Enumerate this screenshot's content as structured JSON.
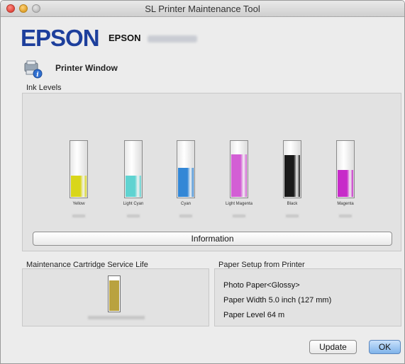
{
  "window": {
    "title": "SL Printer Maintenance Tool"
  },
  "brand": {
    "logo": "EPSON",
    "model_prefix": "EPSON"
  },
  "printer_window": {
    "label": "Printer Window",
    "icon": "printer-info-icon"
  },
  "ink": {
    "section_label": "Ink Levels",
    "tanks": [
      {
        "name": "Yellow",
        "level": 0.37,
        "color": "#d9d61a"
      },
      {
        "name": "Light Cyan",
        "level": 0.37,
        "color": "#5fd3d1"
      },
      {
        "name": "Cyan",
        "level": 0.51,
        "color": "#3387d6"
      },
      {
        "name": "Light Magenta",
        "level": 0.75,
        "color": "#d35fd5"
      },
      {
        "name": "Black",
        "level": 0.74,
        "color": "#1a1a1a"
      },
      {
        "name": "Magenta",
        "level": 0.47,
        "color": "#c72bc9"
      }
    ],
    "info_button": "Information"
  },
  "maintenance": {
    "section_label": "Maintenance Cartridge Service Life",
    "level": 0.9,
    "color": "#b9a23f"
  },
  "paper": {
    "section_label": "Paper Setup from Printer",
    "lines": [
      "Photo Paper<Glossy>",
      "Paper Width 5.0 inch (127 mm)",
      "Paper Level 64 m"
    ]
  },
  "buttons": {
    "update": "Update",
    "ok": "OK"
  }
}
